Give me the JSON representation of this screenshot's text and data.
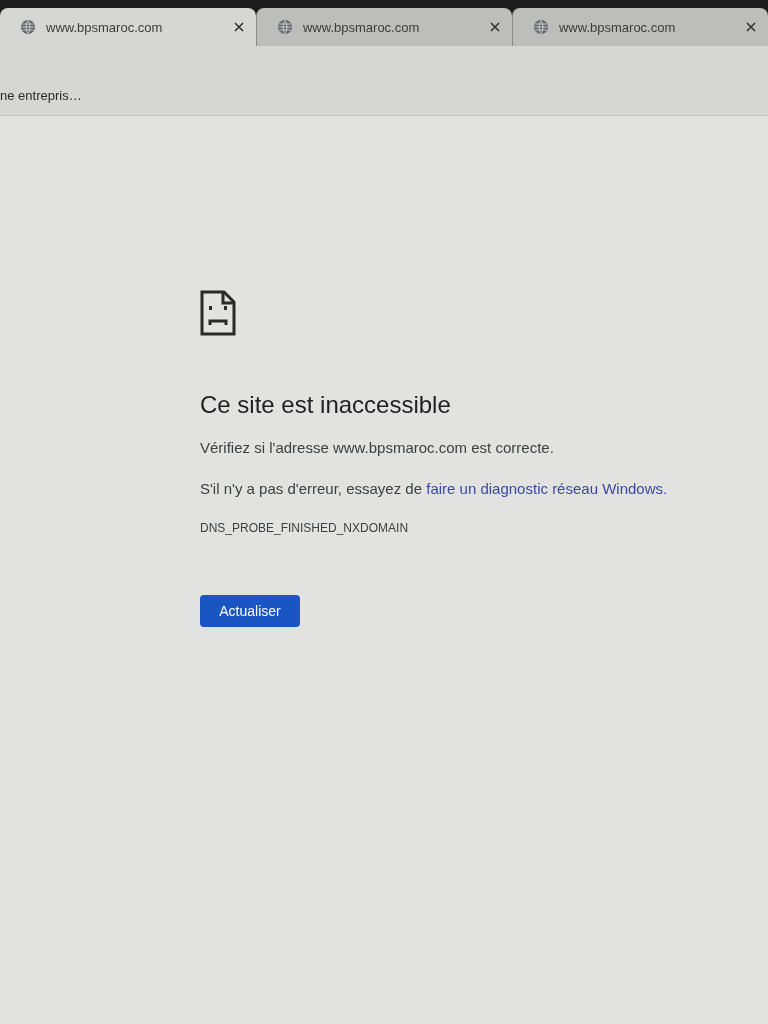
{
  "tabs": [
    {
      "title": "www.bpsmaroc.com",
      "selected": true
    },
    {
      "title": "www.bpsmaroc.com",
      "selected": false
    },
    {
      "title": "www.bpsmaroc.com",
      "selected": false
    }
  ],
  "bookmarks_bar": {
    "items": [
      "ne entrepris…"
    ]
  },
  "error_page": {
    "heading": "Ce site est inaccessible",
    "message": "Vérifiez si l'adresse www.bpsmaroc.com est correcte.",
    "suggestion": {
      "text": "S'il n'y a pas d'erreur, essayez de ",
      "link": "faire un diagnostic réseau Windows",
      "after": "."
    },
    "error_code": "DNS_PROBE_FINISHED_NXDOMAIN",
    "reload_button": "Actualiser"
  }
}
